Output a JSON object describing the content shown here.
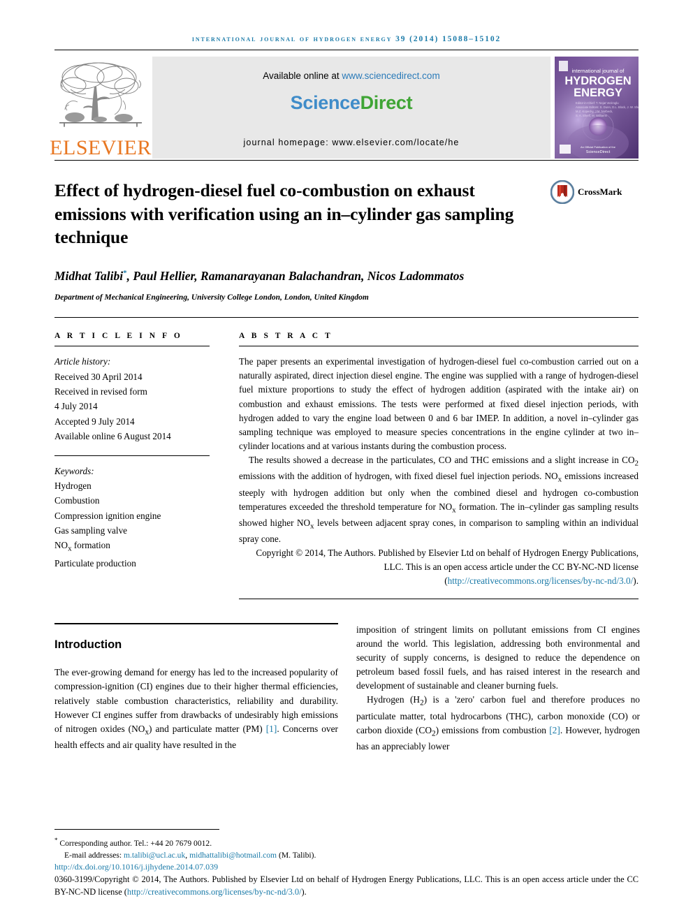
{
  "running_head": "International Journal of Hydrogen Energy 39 (2014) 15088–15102",
  "masthead": {
    "publisher_name": "ELSEVIER",
    "available_text": "Available online at ",
    "available_url": "www.sciencedirect.com",
    "brand_part1": "Science",
    "brand_part2": "Direct",
    "homepage": "journal homepage: www.elsevier.com/locate/he",
    "cover": {
      "line1": "international journal of",
      "line2": "HYDROGEN",
      "line3": "ENERGY",
      "footer_brand": "ScienceDirect"
    },
    "colors": {
      "link": "#2b7bb9",
      "brand_green": "#3fa535",
      "brand_blue": "#3f8cc9",
      "elsevier_orange": "#e87722"
    }
  },
  "article": {
    "title": "Effect of hydrogen-diesel fuel co-combustion on exhaust emissions with verification using an in–cylinder gas sampling technique",
    "crossmark_label": "CrossMark",
    "authors": "Midhat Talibi",
    "author_marker": "*",
    "authors_rest": ", Paul Hellier, Ramanarayanan Balachandran, Nicos Ladommatos",
    "affiliation": "Department of Mechanical Engineering, University College London, London, United Kingdom"
  },
  "info": {
    "heading": "A R T I C L E   I N F O",
    "history_label": "Article history:",
    "history": [
      "Received 30 April 2014",
      "Received in revised form",
      "4 July 2014",
      "Accepted 9 July 2014",
      "Available online 6 August 2014"
    ],
    "keywords_label": "Keywords:",
    "keywords": [
      "Hydrogen",
      "Combustion",
      "Compression ignition engine",
      "Gas sampling valve",
      "NOx formation",
      "Particulate production"
    ]
  },
  "abstract": {
    "heading": "A B S T R A C T",
    "p1": "The paper presents an experimental investigation of hydrogen-diesel fuel co-combustion carried out on a naturally aspirated, direct injection diesel engine. The engine was supplied with a range of hydrogen-diesel fuel mixture proportions to study the effect of hydrogen addition (aspirated with the intake air) on combustion and exhaust emissions. The tests were performed at fixed diesel injection periods, with hydrogen added to vary the engine load between 0 and 6 bar IMEP. In addition, a novel in–cylinder gas sampling technique was employed to measure species concentrations in the engine cylinder at two in–cylinder locations and at various instants during the combustion process.",
    "p2": "The results showed a decrease in the particulates, CO and THC emissions and a slight increase in CO2 emissions with the addition of hydrogen, with fixed diesel fuel injection periods. NOx emissions increased steeply with hydrogen addition but only when the combined diesel and hydrogen co-combustion temperatures exceeded the threshold temperature for NOx formation. The in–cylinder gas sampling results showed higher NOx levels between adjacent spray cones, in comparison to sampling within an individual spray cone.",
    "copyright": "Copyright © 2014, The Authors. Published by Elsevier Ltd on behalf of Hydrogen Energy Publications, LLC. This is an open access article under the CC BY-NC-ND license (",
    "copyright_link": "http://creativecommons.org/licenses/by-nc-nd/3.0/",
    "copyright_end": ")."
  },
  "introduction": {
    "heading": "Introduction",
    "left_p1": "The ever-growing demand for energy has led to the increased popularity of compression-ignition (CI) engines due to their higher thermal efficiencies, relatively stable combustion characteristics, reliability and durability. However CI engines suffer from drawbacks of undesirably high emissions of nitrogen oxides (NOx) and particulate matter (PM) ",
    "left_cite1": "[1]",
    "left_p1_end": ". Concerns over health effects and air quality have resulted in the",
    "right_p1": "imposition of stringent limits on pollutant emissions from CI engines around the world. This legislation, addressing both environmental and security of supply concerns, is designed to reduce the dependence on petroleum based fossil fuels, and has raised interest in the research and development of sustainable and cleaner burning fuels.",
    "right_p2_a": "Hydrogen (H2) is a 'zero' carbon fuel and therefore produces no particulate matter, total hydrocarbons (THC), carbon monoxide (CO) or carbon dioxide (CO2) emissions from combustion ",
    "right_cite2": "[2]",
    "right_p2_b": ". However, hydrogen has an appreciably lower"
  },
  "footer": {
    "corresponding_marker": "*",
    "corresponding": " Corresponding author. Tel.: +44 20 7679 0012.",
    "email_label": "E-mail addresses: ",
    "email1": "m.talibi@ucl.ac.uk",
    "email_sep": ", ",
    "email2": "midhattalibi@hotmail.com",
    "email_suffix": " (M. Talibi).",
    "doi": "http://dx.doi.org/10.1016/j.ijhydene.2014.07.039",
    "issn_a": "0360-3199/Copyright © 2014, The Authors. Published by Elsevier Ltd on behalf of Hydrogen Energy Publications, LLC. This is an open access article under the CC BY-NC-ND license (",
    "issn_link": "http://creativecommons.org/licenses/by-nc-nd/3.0/",
    "issn_b": ")."
  }
}
